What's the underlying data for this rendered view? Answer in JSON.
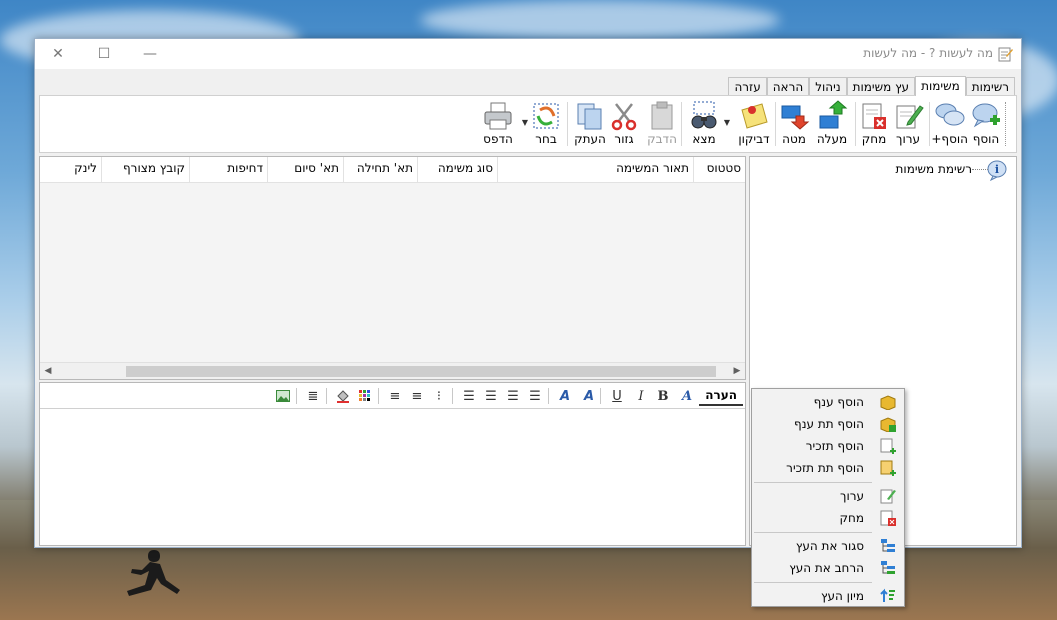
{
  "window": {
    "title": "מה לעשות ? - מה לעשות",
    "controls": {
      "close": "✕",
      "maximize": "☐",
      "minimize": "—"
    }
  },
  "tabs": [
    {
      "label": "רשימות",
      "active": false
    },
    {
      "label": "משימות",
      "active": true
    },
    {
      "label": "עץ משימות",
      "active": false
    },
    {
      "label": "ניהול",
      "active": false
    },
    {
      "label": "הראה",
      "active": false
    },
    {
      "label": "עזרה",
      "active": false
    }
  ],
  "toolbar": {
    "add": "הוסף",
    "add_plus": "הוסף+",
    "edit": "ערוך",
    "delete": "מחק",
    "up": "מעלה",
    "down": "מטה",
    "sticker": "דביקון",
    "find": "מצא",
    "paste": "הדבק",
    "cut": "גזור",
    "copy": "העתק",
    "select": "בחר",
    "print": "הדפס"
  },
  "grid": {
    "columns": [
      "סטטוס",
      "תאור המשימה",
      "סוג משימה",
      "תא' תחילה",
      "תא' סיום",
      "דחיפות",
      "קובץ מצורף",
      "לינק"
    ]
  },
  "tree": {
    "root_label": "רשימת משימות"
  },
  "editor": {
    "label": "הערה",
    "buttons": {
      "bold": "B",
      "italic": "I",
      "underline": "U"
    }
  },
  "context_menu": {
    "items": [
      {
        "label": "הוסף ענף",
        "icon": "folder-add-icon"
      },
      {
        "label": "הוסף תת ענף",
        "icon": "subfolder-add-icon"
      },
      {
        "label": "הוסף תזכיר",
        "icon": "note-add-icon"
      },
      {
        "label": "הוסף תת תזכיר",
        "icon": "subnote-add-icon"
      },
      {
        "label": "ערוך",
        "icon": "edit-icon"
      },
      {
        "label": "מחק",
        "icon": "delete-icon"
      },
      {
        "label": "סגור את העץ",
        "icon": "collapse-tree-icon"
      },
      {
        "label": "הרחב את העץ",
        "icon": "expand-tree-icon"
      },
      {
        "label": "מיון העץ",
        "icon": "sort-tree-icon"
      }
    ]
  }
}
